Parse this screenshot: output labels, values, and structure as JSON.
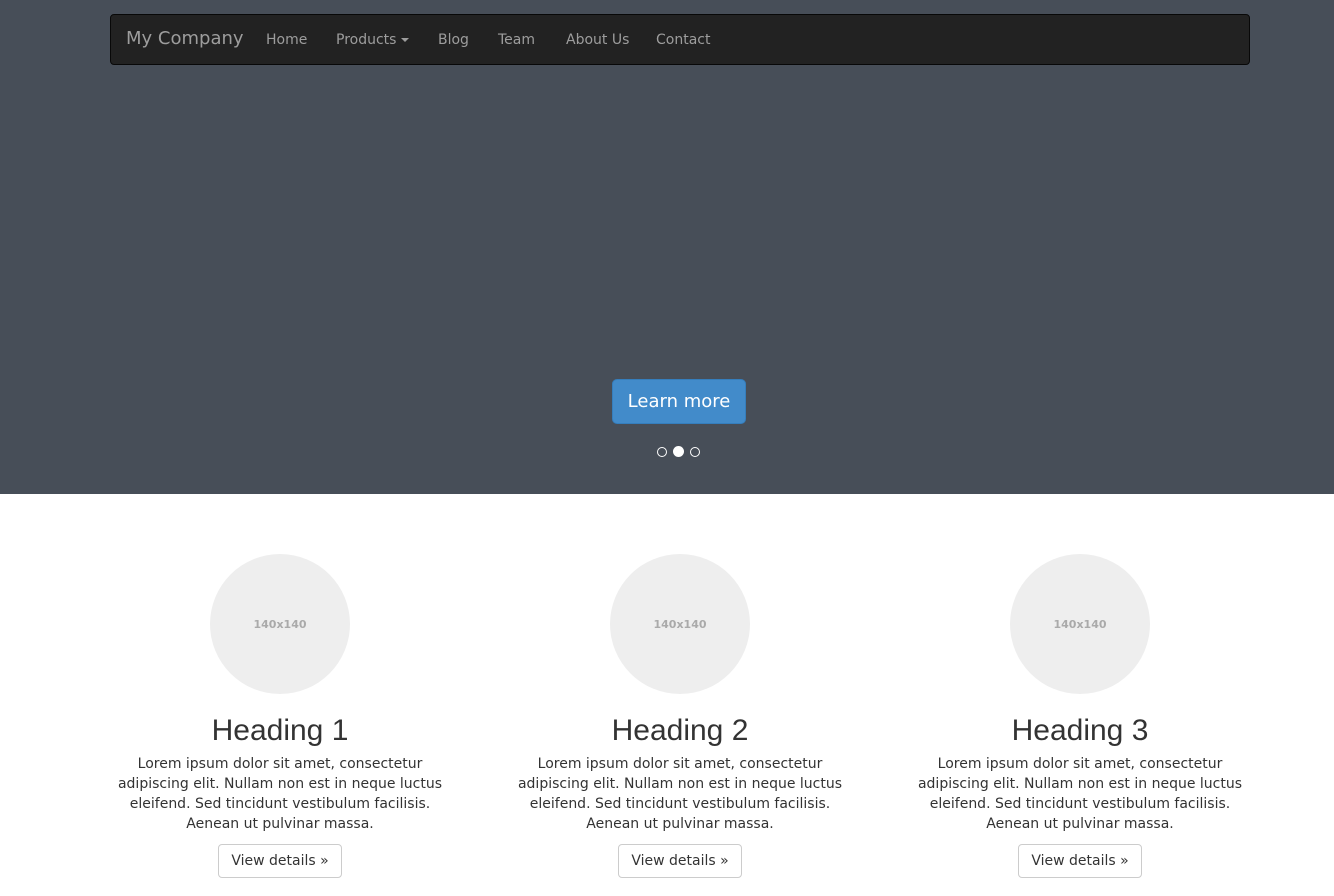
{
  "navbar": {
    "brand": "My Company",
    "items": [
      {
        "label": "Home"
      },
      {
        "label": "Products",
        "has_dropdown": true
      },
      {
        "label": "Blog"
      },
      {
        "label": "Team"
      },
      {
        "label": "About Us"
      },
      {
        "label": "Contact"
      }
    ]
  },
  "carousel": {
    "button_label": "Learn more",
    "slide_count": 3,
    "active_slide": 2
  },
  "features": [
    {
      "image_label": "140x140",
      "heading": "Heading 1",
      "text": "Lorem ipsum dolor sit amet, consectetur adipiscing elit. Nullam non est in neque luctus eleifend. Sed tincidunt vestibulum facilisis. Aenean ut pulvinar massa.",
      "button_label": "View details »"
    },
    {
      "image_label": "140x140",
      "heading": "Heading 2",
      "text": "Lorem ipsum dolor sit amet, consectetur adipiscing elit. Nullam non est in neque luctus eleifend. Sed tincidunt vestibulum facilisis. Aenean ut pulvinar massa.",
      "button_label": "View details »"
    },
    {
      "image_label": "140x140",
      "heading": "Heading 3",
      "text": "Lorem ipsum dolor sit amet, consectetur adipiscing elit. Nullam non est in neque luctus eleifend. Sed tincidunt vestibulum facilisis. Aenean ut pulvinar massa.",
      "button_label": "View details »"
    }
  ],
  "colors": {
    "hero_background": "#474e58",
    "navbar_background": "#222222",
    "primary_button": "#428bca",
    "placeholder_image": "#eeeeee"
  }
}
